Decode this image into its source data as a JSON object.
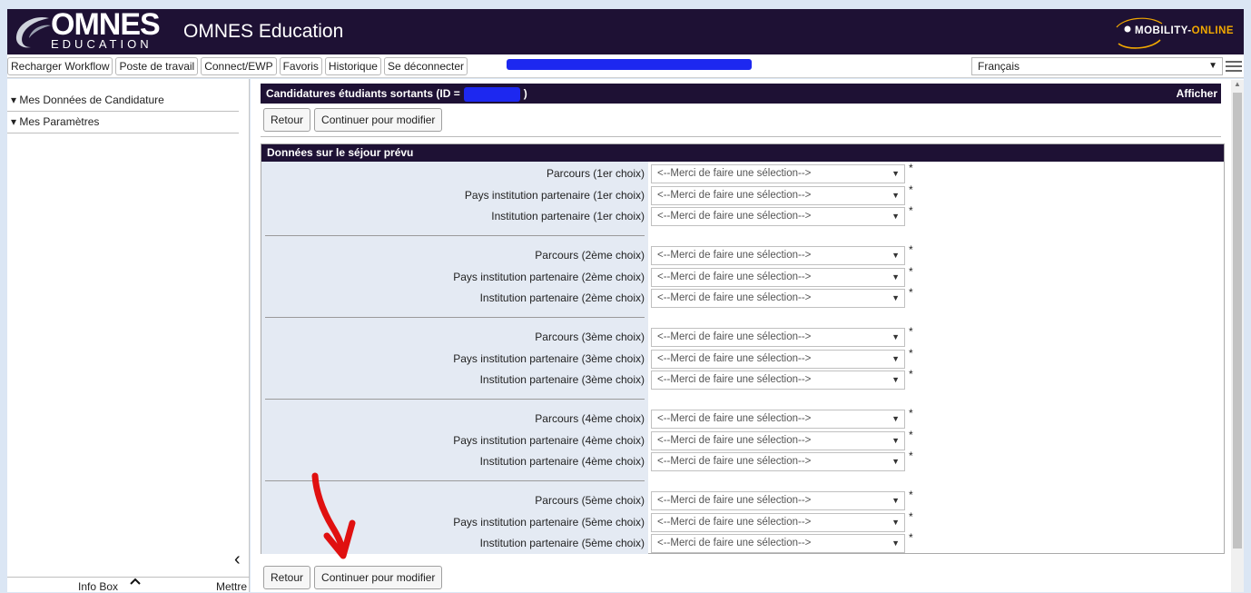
{
  "header": {
    "logo_main": "OMNES",
    "logo_sub": "EDUCATION",
    "app_title": "OMNES Education",
    "mo_logo_part1": "MOBILITY-",
    "mo_logo_part2": "ONLINE"
  },
  "toolbar": {
    "items": [
      "Recharger Workflow",
      "Poste de travail",
      "Connect/EWP",
      "Favoris",
      "Historique",
      "Se déconnecter"
    ],
    "language": "Français"
  },
  "sidebar": {
    "items": [
      "▾ Mes Données de Candidature",
      "▾ Mes Paramètres"
    ],
    "collapse_glyph": "‹",
    "info_box": "Info Box",
    "mettre": "Mettre"
  },
  "main": {
    "panel_title_prefix": "Candidatures étudiants sortants (ID =",
    "panel_title_suffix": ")",
    "afficher": "Afficher",
    "back_label": "Retour",
    "continue_label": "Continuer pour modifier",
    "section_title": "Données sur le séjour prévu",
    "placeholder": "<--Merci de faire une sélection-->",
    "required_mark": "*",
    "fields": [
      "Parcours (1er choix)",
      "Pays institution partenaire (1er choix)",
      "Institution partenaire (1er choix)",
      "Parcours (2ème choix)",
      "Pays institution partenaire (2ème choix)",
      "Institution partenaire (2ème choix)",
      "Parcours (3ème choix)",
      "Pays institution partenaire (3ème choix)",
      "Institution partenaire (3ème choix)",
      "Parcours (4ème choix)",
      "Pays institution partenaire (4ème choix)",
      "Institution partenaire (4ème choix)",
      "Parcours (5ème choix)",
      "Pays institution partenaire (5ème choix)",
      "Institution partenaire (5ème choix)"
    ]
  },
  "colors": {
    "header_bg": "#1e1134",
    "form_bg": "#e4eaf3",
    "page_bg": "#dbe6f4",
    "redaction": "#1d28f0",
    "annotation": "#e01010"
  }
}
